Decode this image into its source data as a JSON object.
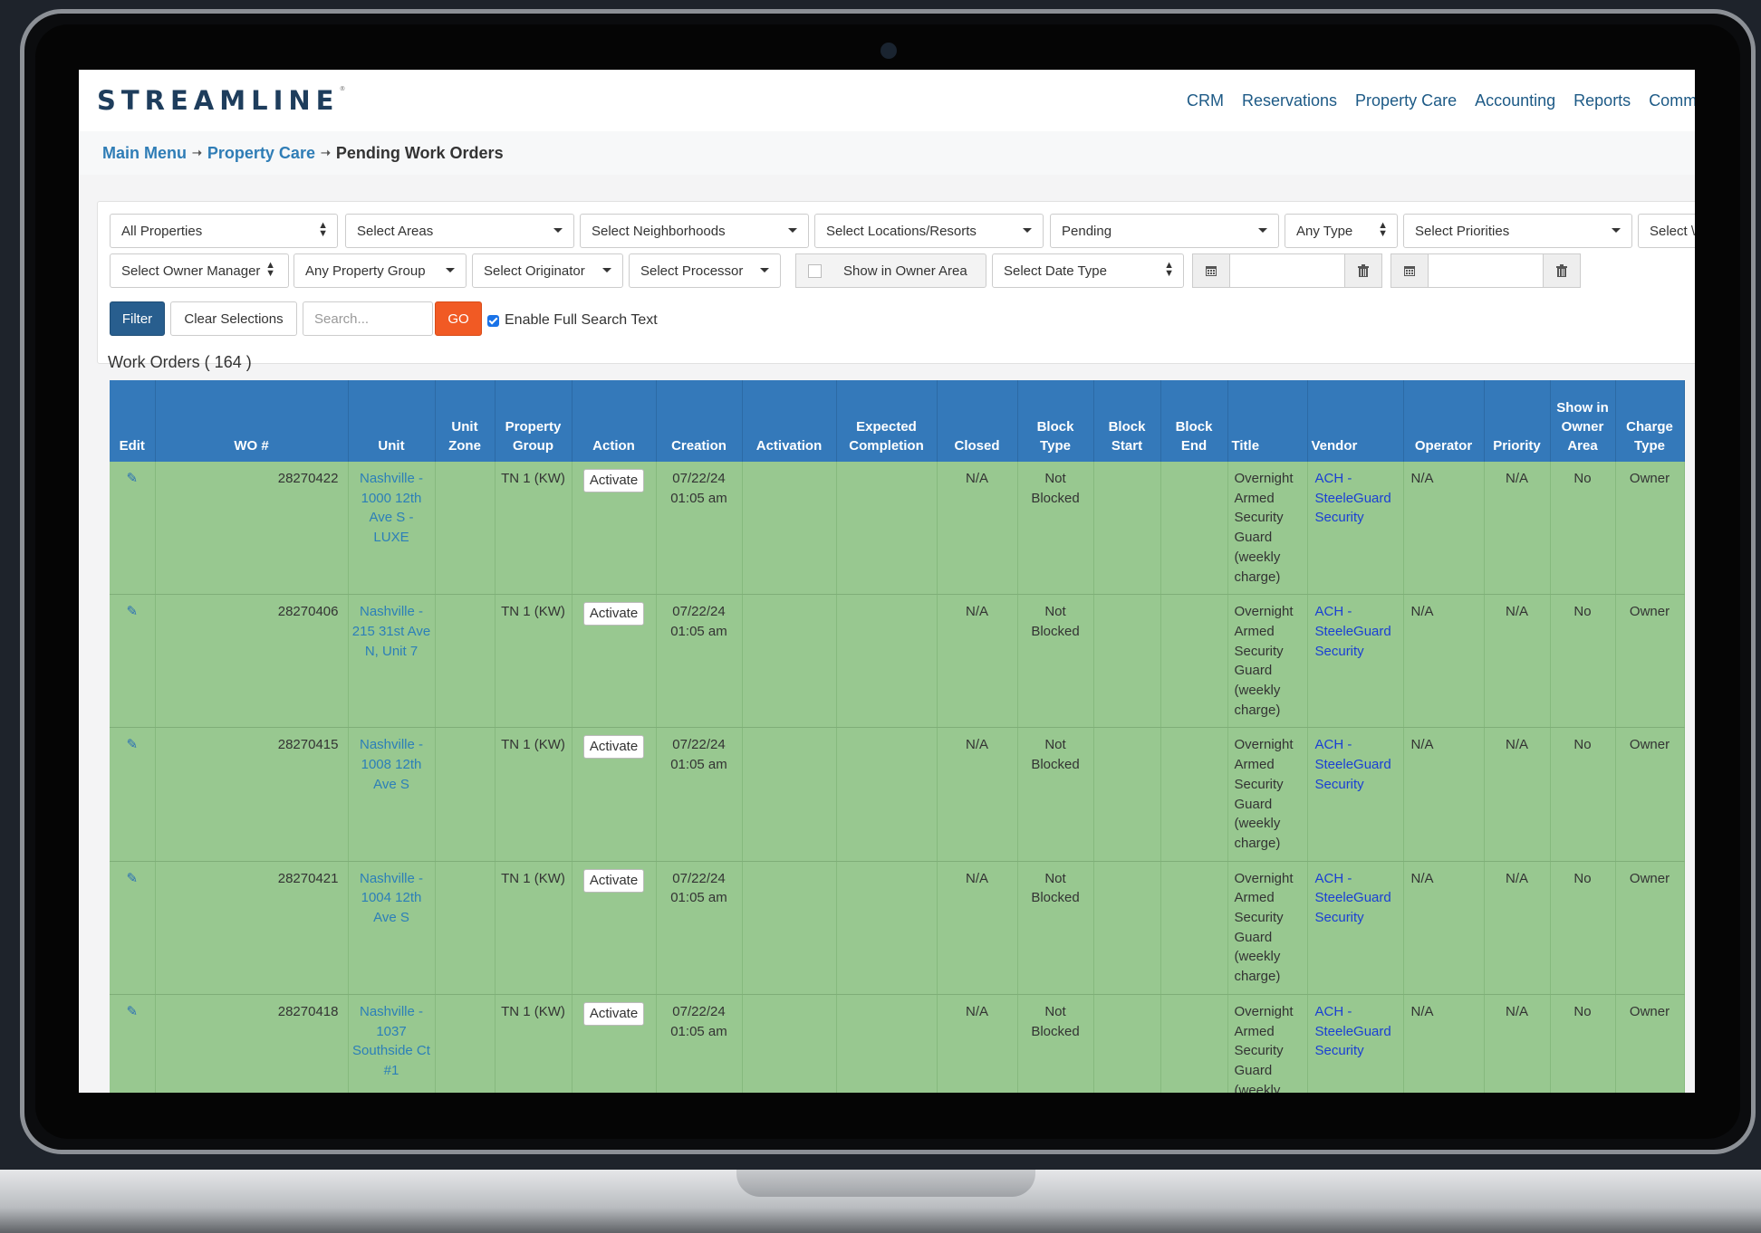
{
  "app": {
    "logo": "STREAMLINE",
    "logo_mark": "®"
  },
  "nav": [
    "CRM",
    "Reservations",
    "Property Care",
    "Accounting",
    "Reports",
    "Comm"
  ],
  "breadcrumb": {
    "main": "Main Menu",
    "section": "Property Care",
    "current": "Pending Work Orders",
    "separator": "➝"
  },
  "filters": {
    "row1": {
      "properties": "All Properties",
      "areas": "Select Areas",
      "neighborhoods": "Select Neighborhoods",
      "locations": "Select Locations/Resorts",
      "status": "Pending",
      "type": "Any Type",
      "priorities": "Select Priorities",
      "more": "Select \\"
    },
    "row2": {
      "owner_manager": "Select Owner Manager",
      "property_group": "Any Property Group",
      "originator": "Select Originator",
      "processor": "Select Processor",
      "owner_area": "Show in Owner Area",
      "date_type": "Select Date Type"
    },
    "row3": {
      "filter": "Filter",
      "clear": "Clear Selections",
      "search_placeholder": "Search...",
      "go": "GO",
      "full_search": "Enable Full Search Text",
      "full_search_checked": true
    }
  },
  "count_label": "Work Orders ( 164 )",
  "table": {
    "columns": [
      "Edit",
      "WO #",
      "Unit",
      "Unit Zone",
      "Property Group",
      "Action",
      "Creation",
      "Activation",
      "Expected Completion",
      "Closed",
      "Block Type",
      "Block Start",
      "Block End",
      "Title",
      "Vendor",
      "Operator",
      "Priority",
      "Show in Owner Area",
      "Charge Type"
    ],
    "rows": [
      {
        "wo": "28270422",
        "unit": "Nashville - 1000 12th Ave S - LUXE",
        "zone": "",
        "group": "TN 1 (KW)",
        "action": "Activate",
        "creation": "07/22/24 01:05 am",
        "activation": "",
        "expected": "",
        "closed": "N/A",
        "block_type": "Not Blocked",
        "block_start": "",
        "block_end": "",
        "title": "Overnight Armed Security Guard (weekly charge)",
        "vendor": "ACH - SteeleGuard Security",
        "operator": "N/A",
        "priority": "N/A",
        "owner_area": "No",
        "charge": "Owner"
      },
      {
        "wo": "28270406",
        "unit": "Nashville - 215 31st Ave N, Unit 7",
        "zone": "",
        "group": "TN 1 (KW)",
        "action": "Activate",
        "creation": "07/22/24 01:05 am",
        "activation": "",
        "expected": "",
        "closed": "N/A",
        "block_type": "Not Blocked",
        "block_start": "",
        "block_end": "",
        "title": "Overnight Armed Security Guard (weekly charge)",
        "vendor": "ACH - SteeleGuard Security",
        "operator": "N/A",
        "priority": "N/A",
        "owner_area": "No",
        "charge": "Owner"
      },
      {
        "wo": "28270415",
        "unit": "Nashville - 1008 12th Ave S",
        "zone": "",
        "group": "TN 1 (KW)",
        "action": "Activate",
        "creation": "07/22/24 01:05 am",
        "activation": "",
        "expected": "",
        "closed": "N/A",
        "block_type": "Not Blocked",
        "block_start": "",
        "block_end": "",
        "title": "Overnight Armed Security Guard (weekly charge)",
        "vendor": "ACH - SteeleGuard Security",
        "operator": "N/A",
        "priority": "N/A",
        "owner_area": "No",
        "charge": "Owner"
      },
      {
        "wo": "28270421",
        "unit": "Nashville - 1004 12th Ave S",
        "zone": "",
        "group": "TN 1 (KW)",
        "action": "Activate",
        "creation": "07/22/24 01:05 am",
        "activation": "",
        "expected": "",
        "closed": "N/A",
        "block_type": "Not Blocked",
        "block_start": "",
        "block_end": "",
        "title": "Overnight Armed Security Guard (weekly charge)",
        "vendor": "ACH - SteeleGuard Security",
        "operator": "N/A",
        "priority": "N/A",
        "owner_area": "No",
        "charge": "Owner"
      },
      {
        "wo": "28270418",
        "unit": "Nashville - 1037 Southside Ct #1",
        "zone": "",
        "group": "TN 1 (KW)",
        "action": "Activate",
        "creation": "07/22/24 01:05 am",
        "activation": "",
        "expected": "",
        "closed": "N/A",
        "block_type": "Not Blocked",
        "block_start": "",
        "block_end": "",
        "title": "Overnight Armed Security Guard (weekly charge)",
        "vendor": "ACH - SteeleGuard Security",
        "operator": "N/A",
        "priority": "N/A",
        "owner_area": "No",
        "charge": "Owner"
      }
    ]
  },
  "colors": {
    "header_blue": "#3479ba",
    "row_green": "#98c890",
    "filter_blue": "#285e8e",
    "go_orange": "#f15a24",
    "link_blue": "#2c7fb8"
  }
}
